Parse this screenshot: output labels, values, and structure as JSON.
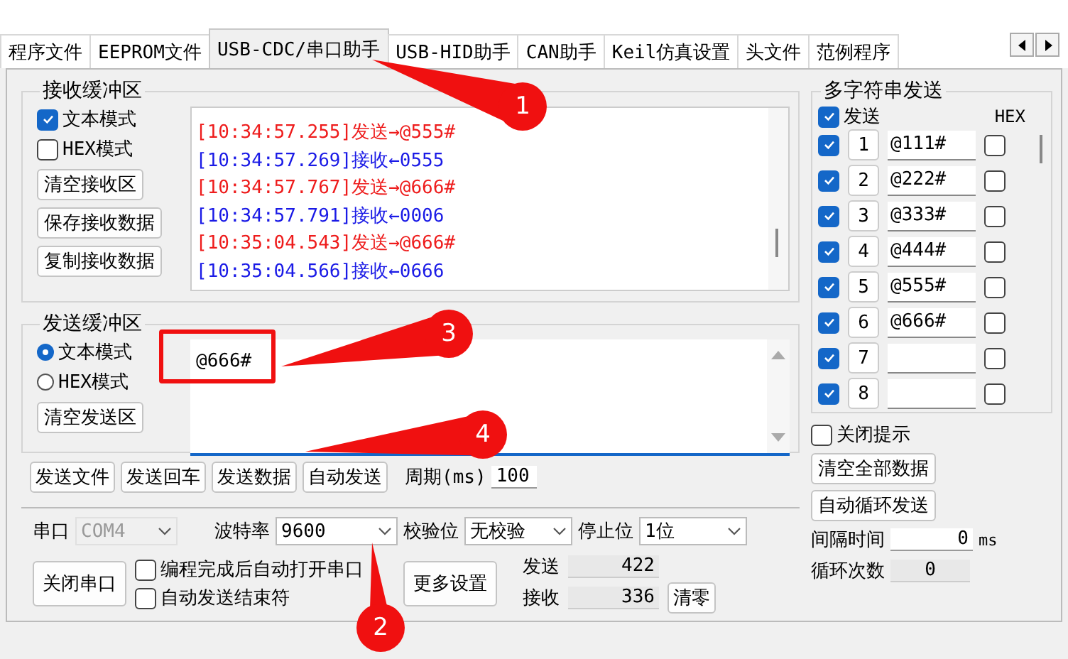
{
  "tabs": [
    {
      "label": "程序文件",
      "selected": false
    },
    {
      "label": "EEPROM文件",
      "selected": false
    },
    {
      "label": "USB-CDC/串口助手",
      "selected": true
    },
    {
      "label": "USB-HID助手",
      "selected": false
    },
    {
      "label": "CAN助手",
      "selected": false
    },
    {
      "label": "Keil仿真设置",
      "selected": false
    },
    {
      "label": "头文件",
      "selected": false
    },
    {
      "label": "范例程序",
      "selected": false
    }
  ],
  "receive_buffer": {
    "title": "接收缓冲区",
    "options": [
      {
        "label": "文本模式",
        "checked": true
      },
      {
        "label": "HEX模式",
        "checked": false
      }
    ],
    "buttons": [
      "清空接收区",
      "保存接收数据",
      "复制接收数据"
    ],
    "log": [
      {
        "kind": "send",
        "text": "[10:34:57.255]发送→@555#"
      },
      {
        "kind": "recv",
        "text": "[10:34:57.269]接收←0555"
      },
      {
        "kind": "send",
        "text": "[10:34:57.767]发送→@666#"
      },
      {
        "kind": "recv",
        "text": "[10:34:57.791]接收←0006"
      },
      {
        "kind": "send",
        "text": "[10:35:04.543]发送→@666#"
      },
      {
        "kind": "recv",
        "text": "[10:35:04.566]接收←0666"
      }
    ]
  },
  "send_buffer": {
    "title": "发送缓冲区",
    "modes": [
      {
        "label": "文本模式",
        "selected": true
      },
      {
        "label": "HEX模式",
        "selected": false
      }
    ],
    "clear_button": "清空发送区",
    "value": "@666#"
  },
  "send_actions": {
    "buttons": [
      "发送文件",
      "发送回车",
      "发送数据",
      "自动发送"
    ],
    "period_label": "周期(ms)",
    "period_value": "100"
  },
  "port": {
    "port_label": "串口",
    "port_value": "COM4",
    "port_disabled": true,
    "baud_label": "波特率",
    "baud_value": "9600",
    "parity_label": "校验位",
    "parity_value": "无校验",
    "stop_label": "停止位",
    "stop_value": "1位",
    "close_button": "关闭串口",
    "options": [
      {
        "label": "编程完成后自动打开串口",
        "checked": false
      },
      {
        "label": "自动发送结束符",
        "checked": false
      }
    ],
    "more_button": "更多设置",
    "sent_label": "发送",
    "sent_value": "422",
    "received_label": "接收",
    "received_value": "336",
    "reset_button": "清零"
  },
  "multi_send": {
    "title": "多字符串发送",
    "send_all": {
      "label": "发送",
      "checked": true
    },
    "hex_label": "HEX",
    "rows": [
      {
        "number": "1",
        "checked": true,
        "value": "@111#",
        "hex": false
      },
      {
        "number": "2",
        "checked": true,
        "value": "@222#",
        "hex": false
      },
      {
        "number": "3",
        "checked": true,
        "value": "@333#",
        "hex": false
      },
      {
        "number": "4",
        "checked": true,
        "value": "@444#",
        "hex": false
      },
      {
        "number": "5",
        "checked": true,
        "value": "@555#",
        "hex": false
      },
      {
        "number": "6",
        "checked": true,
        "value": "@666#",
        "hex": false
      },
      {
        "number": "7",
        "checked": true,
        "value": "",
        "hex": false
      },
      {
        "number": "8",
        "checked": true,
        "value": "",
        "hex": false
      }
    ],
    "close_tips": {
      "label": "关闭提示",
      "checked": false
    },
    "clear_button": "清空全部数据",
    "loop_button": "自动循环发送",
    "interval_label": "间隔时间",
    "interval_value": "0",
    "interval_unit": "ms",
    "loop_count_label": "循环次数",
    "loop_count_value": "0"
  },
  "callouts": [
    {
      "number": "1"
    },
    {
      "number": "2"
    },
    {
      "number": "3"
    },
    {
      "number": "4"
    }
  ]
}
